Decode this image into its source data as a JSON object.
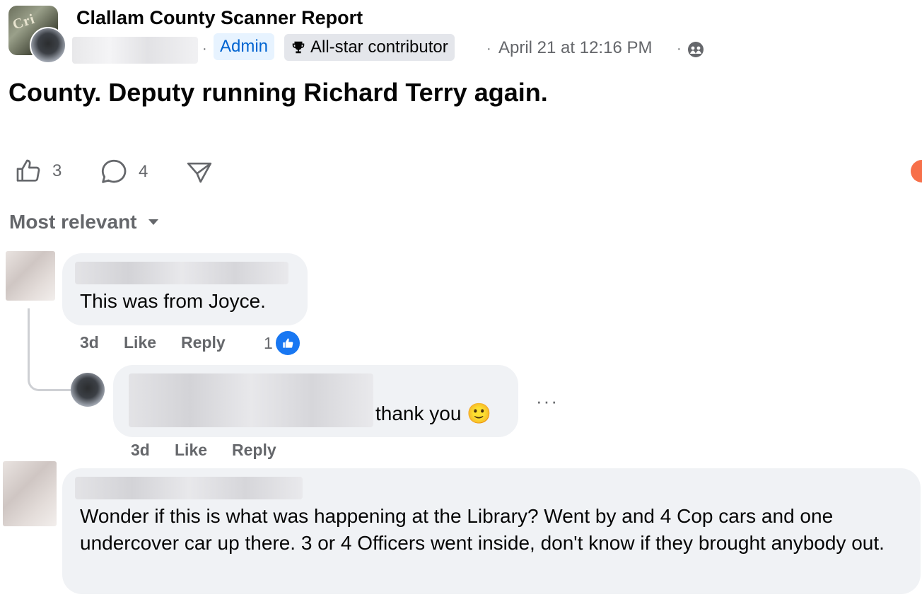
{
  "post": {
    "group_name": "Clallam County Scanner Report",
    "group_avatar_text": "Cri",
    "badges": {
      "admin": "Admin",
      "allstar": "All-star contributor"
    },
    "date": "April 21 at 12:16 PM",
    "separator": "·",
    "text": "County. Deputy running Richard Terry again."
  },
  "actions": {
    "like_count": "3",
    "comment_count": "4"
  },
  "sort": {
    "label": "Most relevant"
  },
  "comments": [
    {
      "text": "This was from Joyce.",
      "time": "3d",
      "like": "Like",
      "reply": "Reply",
      "reaction_count": "1"
    },
    {
      "text": "thank you 🙂",
      "time": "3d",
      "like": "Like",
      "reply": "Reply",
      "more": "···"
    },
    {
      "text": "Wonder if this is what was happening at the Library? Went by and 4 Cop cars and one undercover car up there. 3 or 4 Officers went inside, don't know if they brought anybody out."
    }
  ],
  "colors": {
    "accent": "#1877f2",
    "admin_text": "#0064d1",
    "bubble": "#f0f2f5",
    "meta": "#65676b"
  },
  "icons": [
    "thumbs-up-icon",
    "comment-icon",
    "share-icon",
    "trophy-icon",
    "audience-icon",
    "caret-down-icon"
  ]
}
